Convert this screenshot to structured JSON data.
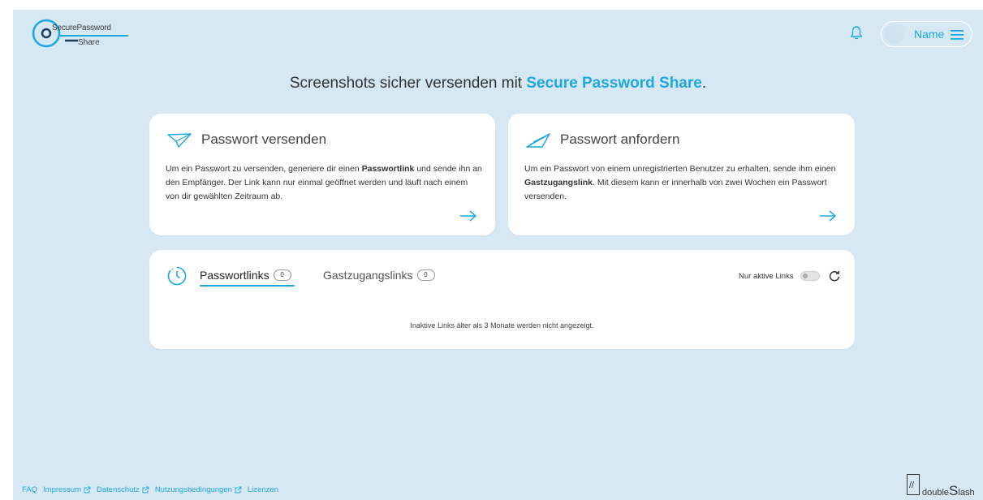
{
  "header": {
    "logo_line1": "SecurePassword",
    "logo_line2": "Share",
    "user_name": "Name"
  },
  "headline": {
    "text_before": "Screenshots sicher versenden mit ",
    "brand": "Secure Password Share",
    "text_after": "."
  },
  "cards": {
    "send": {
      "title": "Passwort versenden",
      "body_1": "Um ein Passwort zu versenden, generiere dir einen ",
      "body_bold": "Passwortlink",
      "body_2": " und sende ihn an den Empfänger. Der Link kann nur einmal geöffnet werden und läuft nach einem von dir gewählten Zeitraum ab."
    },
    "request": {
      "title": "Passwort anfordern",
      "body_1": "Um ein Passwort von einem unregistrierten Benutzer zu erhalten, sende ihm einen ",
      "body_bold": "Gastzugangslink",
      "body_2": ". Mit diesem kann er innerhalb von zwei Wochen ein Passwort versenden."
    }
  },
  "links": {
    "tabs": [
      {
        "label": "Passwortlinks",
        "count": "0"
      },
      {
        "label": "Gastzugangslinks",
        "count": "0"
      }
    ],
    "active_tab": "Passwortlinks",
    "toggle_label": "Nur aktive Links",
    "toggle_on": false,
    "info": "Inaktive Links älter als 3 Monate werden nicht angezeigt."
  },
  "footer": {
    "items": [
      "FAQ",
      "Impressum",
      "Datenschutz",
      "Nutzungsbedingungen",
      "Lizenzen"
    ],
    "brand_prefix": "double",
    "brand_s": "S",
    "brand_suffix": "lash",
    "brand_mark": "//"
  },
  "colors": {
    "accent": "#1ea7e1",
    "background": "#d6e8f4",
    "card": "#ffffff"
  },
  "icons": [
    "logo-key-icon",
    "bell-icon",
    "menu-icon",
    "paper-plane-icon",
    "paper-plane-outline-icon",
    "arrow-right-icon",
    "clock-icon",
    "refresh-icon",
    "external-link-icon"
  ]
}
